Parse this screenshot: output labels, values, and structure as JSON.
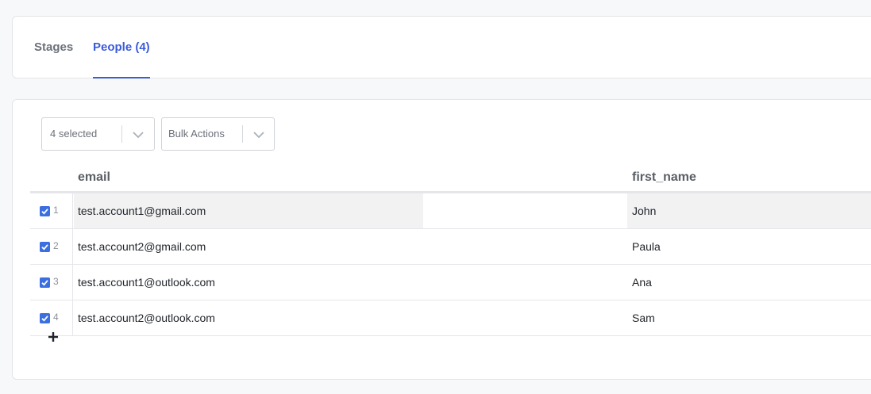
{
  "tabs": [
    {
      "label": "Stages",
      "active": false
    },
    {
      "label": "People (4)",
      "active": true
    }
  ],
  "toolbar": {
    "selection_label": "4 selected",
    "bulk_actions_label": "Bulk Actions"
  },
  "table": {
    "columns": [
      "email",
      "first_name"
    ],
    "rows": [
      {
        "num": "1",
        "email": "test.account1@gmail.com",
        "first_name": "John",
        "checked": true
      },
      {
        "num": "2",
        "email": "test.account2@gmail.com",
        "first_name": "Paula",
        "checked": true
      },
      {
        "num": "3",
        "email": "test.account1@outlook.com",
        "first_name": "Ana",
        "checked": true
      },
      {
        "num": "4",
        "email": "test.account2@outlook.com",
        "first_name": "Sam",
        "checked": true
      }
    ]
  },
  "icons": {
    "checkbox": "checkmark-icon",
    "dropdown": "chevron-down-icon",
    "add_row": "plus-icon"
  },
  "colors": {
    "accent": "#3b5bd9",
    "checkbox": "#3b6fe0"
  }
}
